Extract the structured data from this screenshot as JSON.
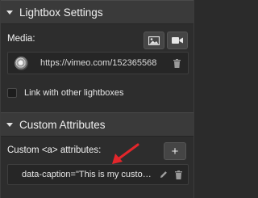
{
  "lightbox": {
    "title": "Lightbox Settings",
    "media_label": "Media:",
    "image_button_icon": "image-icon",
    "video_button_icon": "video-camera-icon",
    "media_item": {
      "url": "https://vimeo.com/152365568",
      "thumbnail_icon": "video-thumbnail",
      "delete_icon": "trash-icon"
    },
    "link_checkbox_label": "Link with other lightboxes",
    "link_checkbox_checked": false
  },
  "custom_attributes": {
    "title": "Custom Attributes",
    "attributes_label": "Custom <a> attributes:",
    "add_button_label": "+",
    "items": [
      {
        "text": "data-caption=\"This is my custom caption\"",
        "edit_icon": "pencil-icon",
        "delete_icon": "trash-icon"
      }
    ]
  },
  "annotation": {
    "arrow_color": "#e2262b"
  }
}
